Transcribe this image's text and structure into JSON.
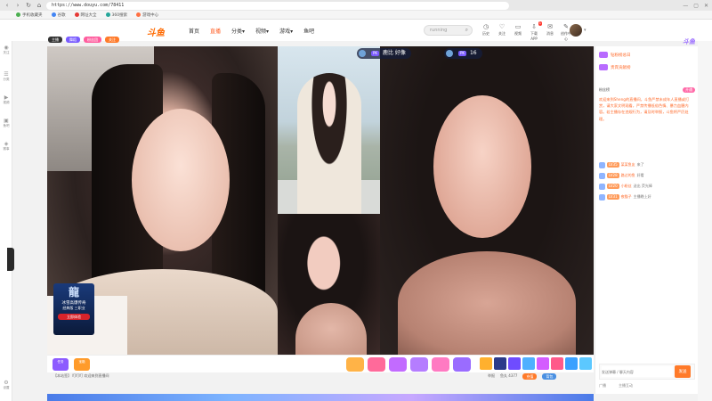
{
  "browser": {
    "url": "https://www.douyu.com/78411",
    "nav": [
      "‹",
      "›",
      "↻",
      "⌂"
    ],
    "window_controls": [
      "—",
      "▢",
      "✕"
    ]
  },
  "bookmarks": [
    {
      "label": "手机收藏夹",
      "color": "#4caf50"
    },
    {
      "label": "谷歌",
      "color": "#4285f4"
    },
    {
      "label": "网址大全",
      "color": "#e53935"
    },
    {
      "label": "360搜索",
      "color": "#26a69a"
    },
    {
      "label": "游戏中心",
      "color": "#ff7043"
    }
  ],
  "header": {
    "logo": "斗鱼",
    "nav": [
      "首页",
      "直播",
      "分类▾",
      "视频▾",
      "游戏▾",
      "鱼吧"
    ],
    "active_index": 1,
    "search_placeholder": "running",
    "icons": [
      {
        "name": "history-icon",
        "glyph": "◷",
        "label": "历史"
      },
      {
        "name": "follow-icon",
        "glyph": "♡",
        "label": "关注"
      },
      {
        "name": "video-icon",
        "glyph": "▭",
        "label": "视频"
      },
      {
        "name": "download-icon",
        "glyph": "⇩",
        "label": "下载APP",
        "badge": "1"
      },
      {
        "name": "message-icon",
        "glyph": "✉",
        "label": "消息"
      },
      {
        "name": "create-icon",
        "glyph": "✎",
        "label": "创作中心"
      }
    ]
  },
  "left_rail": [
    {
      "glyph": "◉",
      "label": "关注"
    },
    {
      "glyph": "☰",
      "label": "分类"
    },
    {
      "glyph": "▶",
      "label": "视频"
    },
    {
      "glyph": "▣",
      "label": "鱼吧"
    },
    {
      "glyph": "◈",
      "label": "赛事"
    },
    {
      "glyph": "⚙",
      "label": "设置"
    }
  ],
  "room_header_pills": [
    {
      "label": "主播",
      "color": "#333"
    },
    {
      "label": "舞蹈",
      "color": "#7a5cff"
    },
    {
      "label": "粉丝团",
      "color": "#ff5d9e"
    },
    {
      "label": "关注",
      "color": "#ff7a29"
    }
  ],
  "video": {
    "badge_left": {
      "tag": "PK",
      "name": "鹿比 好像"
    },
    "badge_right": {
      "tag": "PK",
      "count": "16"
    }
  },
  "promo": {
    "big": "龍",
    "title": "冰雪高爆传奇",
    "sub": "经典版 三职业",
    "cta": "立即体验"
  },
  "gift_bar": {
    "left": [
      {
        "label": "任务",
        "color": "#8d5bff"
      },
      {
        "label": "宝箱",
        "color": "#ff9b2a"
      }
    ],
    "middle_colors": [
      "#ffb347",
      "#ff6a9a",
      "#c26bff",
      "#b57dff",
      "#ff7ac2",
      "#9a6cff"
    ],
    "right_colors": [
      "#ffb02e",
      "#2b3a8a",
      "#6f4cff",
      "#4fb0ff",
      "#d45cff",
      "#ff5a8a",
      "#3aa0ff",
      "#5cc8ff"
    ]
  },
  "below_video": {
    "announcement": "【本站签】 叮叮叮 欢迎来到直播间",
    "right_items": [
      "举报",
      "鱼丸 4377"
    ],
    "buttons": [
      "充值",
      "背包"
    ]
  },
  "chat": {
    "brand": "斗鱼",
    "ranks": [
      "钻粉榜总日",
      "贵宾贡献榜"
    ],
    "fans_label": "粉丝榜",
    "fans_pill": "开通",
    "notice": "欢迎来到Sheng的直播间，斗鱼严禁未成年人直播或打赏，请大家文明观看，严禁传播低俗色情、暴力血腥内容。若主播存在违规行为，请及时举报，斗鱼将严厉处理。",
    "messages": [
      {
        "lv": "LV35",
        "name": "某某鱼友",
        "text": "来了"
      },
      {
        "lv": "LV28",
        "name": "路过的鱼",
        "text": "好看"
      },
      {
        "lv": "LV20",
        "name": "小粉丝",
        "text": "送出 荧光棒"
      },
      {
        "lv": "LV31",
        "name": "夜猫子",
        "text": "主播晚上好"
      }
    ],
    "input_placeholder": "发送弹幕 / 聊天内容",
    "send_label": "发送",
    "bottom": [
      "广播",
      "主播互动"
    ]
  }
}
